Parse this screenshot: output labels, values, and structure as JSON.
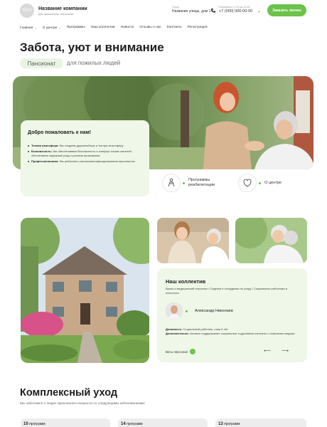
{
  "header": {
    "logo_text": "ЛОГО",
    "company_name": "Название компании",
    "tagline": "Для преклонных: пансионат",
    "address_label": "Город",
    "address": "Название улицы, дом 1",
    "hours": "Ежедневно с 9:00 до 21:00",
    "phone": "+7 (000) 000-00-00",
    "order_call": "Заказать звонок",
    "accent_color": "#6cc24a"
  },
  "nav": [
    {
      "label": "Главная",
      "dropdown": true
    },
    {
      "label": "О центре",
      "dropdown": true
    },
    {
      "label": "Программы",
      "dropdown": false
    },
    {
      "label": "Наш коллектив",
      "dropdown": false
    },
    {
      "label": "Новости",
      "dropdown": false
    },
    {
      "label": "Отзывы о нас",
      "dropdown": false
    },
    {
      "label": "Контакты",
      "dropdown": false
    },
    {
      "label": "Регистрация",
      "dropdown": false
    }
  ],
  "hero": {
    "title": "Забота, уют и внимание",
    "pill": "Пансионат",
    "subtitle": "для пожилых людей"
  },
  "welcome": {
    "title": "Добро пожаловать к нам!",
    "items": [
      {
        "bold": "Теплая атмосфера:",
        "text": " Мы создаем дружелюбную и теплую атмосферу."
      },
      {
        "bold": "Безопасность:",
        "text": " Мы обеспечиваем безопасность и комфорт наших жителей, обеспечивая надежный уход и условия проживания."
      },
      {
        "bold": "Профессионализм:",
        "text": " Мы работаем с высококвалифицированным персоналом"
      }
    ]
  },
  "features": [
    {
      "label_1": "Программы",
      "label_2": "реабилитации",
      "icon": "rehab-icon"
    },
    {
      "label_1": "О центре",
      "label_2": "",
      "icon": "center-icon"
    }
  ],
  "team": {
    "title": "Наш коллектив",
    "roles": "Врачи и медицинский персонал / Сиделки и сотрудники по уходу / Социальные работники и психологи",
    "person_name": "Александр Николаев",
    "position_label": "Должность:",
    "position_value": " Социальный работник, стаж 6 лет",
    "extra_label": "Дополнительно:",
    "extra_value": " Активно поддерживает социальные и душевные контакты с пожилыми людьми",
    "all_staff": "Весь персонал",
    "prev_arrow": "⟵",
    "next_arrow": "⟶",
    "next_icon": "→"
  },
  "complex": {
    "title": "Комплексный уход",
    "subtitle": "Мы заботимся о людях преклонного возраста со следующими заболеваниями:",
    "cards": [
      {
        "count": "10",
        "unit": "программ"
      },
      {
        "count": "14",
        "unit": "программ"
      },
      {
        "count": "13",
        "unit": "программ"
      }
    ]
  }
}
